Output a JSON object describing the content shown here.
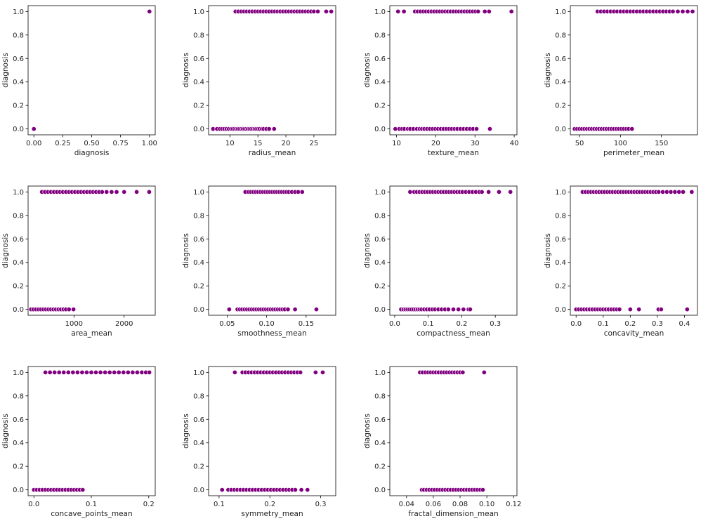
{
  "figure": {
    "background": "#ffffff"
  },
  "style": {
    "point_color": "#800080",
    "point_edge": "#ffffff"
  },
  "chart_data": [
    {
      "type": "scatter",
      "xlabel": "diagnosis",
      "ylabel": "diagnosis",
      "xlim": [
        -0.05,
        1.05
      ],
      "ylim": [
        -0.05,
        1.05
      ],
      "xticks": [
        0.0,
        0.25,
        0.5,
        0.75,
        1.0
      ],
      "xtick_labels": [
        "0.00",
        "0.25",
        "0.50",
        "0.75",
        "1.00"
      ],
      "yticks": [
        0.0,
        0.2,
        0.4,
        0.6,
        0.8,
        1.0
      ],
      "ytick_labels": [
        "0.0",
        "0.2",
        "0.4",
        "0.6",
        "0.8",
        "1.0"
      ],
      "points": {
        "y0": [
          0.0
        ],
        "y1": [
          1.0
        ]
      }
    },
    {
      "type": "scatter",
      "xlabel": "radius_mean",
      "ylabel": "diagnosis",
      "xlim": [
        6.2,
        28.9
      ],
      "ylim": [
        -0.05,
        1.05
      ],
      "xticks": [
        10,
        15,
        20,
        25
      ],
      "xtick_labels": [
        "10",
        "15",
        "20",
        "25"
      ],
      "yticks": [
        0.0,
        0.2,
        0.4,
        0.6,
        0.8,
        1.0
      ],
      "ytick_labels": [
        "0.0",
        "0.2",
        "0.4",
        "0.6",
        "0.8",
        "1.0"
      ],
      "points": {
        "y0": [
          7.0,
          7.7,
          8.2,
          8.6,
          9.0,
          9.4,
          9.8,
          10.2,
          10.5,
          10.8,
          11.1,
          11.4,
          11.7,
          12.0,
          12.3,
          12.6,
          12.9,
          13.2,
          13.5,
          13.8,
          14.1,
          14.4,
          14.7,
          15.0,
          15.3,
          15.7,
          16.0,
          16.5,
          17.0,
          17.9
        ],
        "y1": [
          11.0,
          11.5,
          12.0,
          12.5,
          13.0,
          13.5,
          14.0,
          14.5,
          15.0,
          15.5,
          16.0,
          16.5,
          17.0,
          17.5,
          18.0,
          18.5,
          19.0,
          19.5,
          20.0,
          20.5,
          21.0,
          21.5,
          22.0,
          22.5,
          23.0,
          23.5,
          24.0,
          24.5,
          25.0,
          25.7,
          27.2,
          28.1
        ]
      }
    },
    {
      "type": "scatter",
      "xlabel": "texture_mean",
      "ylabel": "diagnosis",
      "xlim": [
        8.3,
        40.7
      ],
      "ylim": [
        -0.05,
        1.05
      ],
      "xticks": [
        10,
        20,
        30,
        40
      ],
      "xtick_labels": [
        "10",
        "20",
        "30",
        "40"
      ],
      "yticks": [
        0.0,
        0.2,
        0.4,
        0.6,
        0.8,
        1.0
      ],
      "ytick_labels": [
        "0.0",
        "0.2",
        "0.4",
        "0.6",
        "0.8",
        "1.0"
      ],
      "points": {
        "y0": [
          9.7,
          10.7,
          11.4,
          12.0,
          12.9,
          13.5,
          14.3,
          15.2,
          15.9,
          16.5,
          17.1,
          17.8,
          18.5,
          19.2,
          19.9,
          20.6,
          21.3,
          22.0,
          22.7,
          23.4,
          24.1,
          24.8,
          25.5,
          26.3,
          27.1,
          27.9,
          28.7,
          29.5,
          30.4,
          33.8
        ],
        "y1": [
          10.4,
          11.9,
          14.7,
          15.4,
          16.1,
          16.8,
          17.5,
          18.2,
          18.9,
          19.6,
          20.3,
          21.0,
          21.7,
          22.4,
          23.1,
          23.8,
          24.5,
          25.2,
          25.9,
          26.6,
          27.3,
          28.0,
          28.7,
          29.4,
          30.1,
          30.8,
          32.5,
          33.6,
          39.3
        ]
      }
    },
    {
      "type": "scatter",
      "xlabel": "perimeter_mean",
      "ylabel": "diagnosis",
      "xlim": [
        38.8,
        194.0
      ],
      "ylim": [
        -0.05,
        1.05
      ],
      "xticks": [
        50,
        100,
        150
      ],
      "xtick_labels": [
        "50",
        "100",
        "150"
      ],
      "yticks": [
        0.0,
        0.2,
        0.4,
        0.6,
        0.8,
        1.0
      ],
      "ytick_labels": [
        "0.0",
        "0.2",
        "0.4",
        "0.6",
        "0.8",
        "1.0"
      ],
      "points": {
        "y0": [
          44,
          47,
          50,
          53,
          56,
          59,
          62,
          65,
          68,
          71,
          74,
          77,
          80,
          83,
          86,
          89,
          92,
          95,
          98,
          101,
          104,
          107,
          110,
          114
        ],
        "y1": [
          72,
          76,
          80,
          84,
          88,
          92,
          96,
          100,
          104,
          108,
          112,
          116,
          120,
          124,
          128,
          132,
          136,
          140,
          144,
          148,
          152,
          156,
          160,
          164,
          170,
          176,
          182,
          188
        ]
      }
    },
    {
      "type": "scatter",
      "xlabel": "area_mean",
      "ylabel": "diagnosis",
      "xlim": [
        85,
        2620
      ],
      "ylim": [
        -0.05,
        1.05
      ],
      "xticks": [
        1000,
        2000
      ],
      "xtick_labels": [
        "1000",
        "2000"
      ],
      "yticks": [
        0.0,
        0.2,
        0.4,
        0.6,
        0.8,
        1.0
      ],
      "ytick_labels": [
        "0.0",
        "0.2",
        "0.4",
        "0.6",
        "0.8",
        "1.0"
      ],
      "points": {
        "y0": [
          144,
          190,
          240,
          290,
          340,
          390,
          440,
          490,
          540,
          590,
          640,
          690,
          740,
          790,
          840,
          900,
          990
        ],
        "y1": [
          360,
          420,
          480,
          540,
          600,
          660,
          720,
          780,
          840,
          900,
          960,
          1020,
          1080,
          1140,
          1200,
          1260,
          1320,
          1380,
          1440,
          1500,
          1560,
          1650,
          1750,
          1850,
          2000,
          2250,
          2500
        ]
      }
    },
    {
      "type": "scatter",
      "xlabel": "smoothness_mean",
      "ylabel": "diagnosis",
      "xlim": [
        0.0265,
        0.1875
      ],
      "ylim": [
        -0.05,
        1.05
      ],
      "xticks": [
        0.05,
        0.1,
        0.15
      ],
      "xtick_labels": [
        "0.05",
        "0.10",
        "0.15"
      ],
      "yticks": [
        0.0,
        0.2,
        0.4,
        0.6,
        0.8,
        1.0
      ],
      "ytick_labels": [
        "0.0",
        "0.2",
        "0.4",
        "0.6",
        "0.8",
        "1.0"
      ],
      "points": {
        "y0": [
          0.0526,
          0.063,
          0.066,
          0.069,
          0.072,
          0.075,
          0.078,
          0.081,
          0.084,
          0.087,
          0.09,
          0.093,
          0.096,
          0.099,
          0.102,
          0.105,
          0.108,
          0.111,
          0.114,
          0.117,
          0.12,
          0.123,
          0.127,
          0.136,
          0.163
        ],
        "y1": [
          0.073,
          0.077,
          0.08,
          0.083,
          0.086,
          0.089,
          0.092,
          0.095,
          0.098,
          0.101,
          0.104,
          0.107,
          0.11,
          0.113,
          0.116,
          0.119,
          0.122,
          0.125,
          0.128,
          0.132,
          0.136,
          0.14,
          0.145
        ]
      }
    },
    {
      "type": "scatter",
      "xlabel": "compactness_mean",
      "ylabel": "diagnosis",
      "xlim": [
        -0.0145,
        0.3645
      ],
      "ylim": [
        -0.05,
        1.05
      ],
      "xticks": [
        0.0,
        0.1,
        0.2,
        0.3
      ],
      "xtick_labels": [
        "0.0",
        "0.1",
        "0.2",
        "0.3"
      ],
      "yticks": [
        0.0,
        0.2,
        0.4,
        0.6,
        0.8,
        1.0
      ],
      "ytick_labels": [
        "0.0",
        "0.2",
        "0.4",
        "0.6",
        "0.8",
        "1.0"
      ],
      "points": {
        "y0": [
          0.019,
          0.026,
          0.032,
          0.038,
          0.044,
          0.05,
          0.056,
          0.062,
          0.068,
          0.074,
          0.08,
          0.088,
          0.096,
          0.104,
          0.112,
          0.12,
          0.13,
          0.14,
          0.15,
          0.16,
          0.175,
          0.19,
          0.205,
          0.22,
          0.225
        ],
        "y1": [
          0.046,
          0.058,
          0.066,
          0.074,
          0.082,
          0.09,
          0.098,
          0.106,
          0.114,
          0.122,
          0.13,
          0.138,
          0.146,
          0.154,
          0.162,
          0.17,
          0.178,
          0.186,
          0.194,
          0.202,
          0.212,
          0.222,
          0.232,
          0.242,
          0.252,
          0.26,
          0.28,
          0.311,
          0.345
        ]
      }
    },
    {
      "type": "scatter",
      "xlabel": "concavity_mean",
      "ylabel": "diagnosis",
      "xlim": [
        -0.0213,
        0.4481
      ],
      "ylim": [
        -0.05,
        1.05
      ],
      "xticks": [
        0.0,
        0.1,
        0.2,
        0.3,
        0.4
      ],
      "xtick_labels": [
        "0.0",
        "0.1",
        "0.2",
        "0.3",
        "0.4"
      ],
      "yticks": [
        0.0,
        0.2,
        0.4,
        0.6,
        0.8,
        1.0
      ],
      "ytick_labels": [
        "0.0",
        "0.2",
        "0.4",
        "0.6",
        "0.8",
        "1.0"
      ],
      "points": {
        "y0": [
          0.0,
          0.01,
          0.02,
          0.03,
          0.04,
          0.05,
          0.06,
          0.07,
          0.08,
          0.09,
          0.1,
          0.11,
          0.12,
          0.13,
          0.14,
          0.15,
          0.16,
          0.2,
          0.232,
          0.304,
          0.314,
          0.41
        ],
        "y1": [
          0.024,
          0.035,
          0.045,
          0.055,
          0.065,
          0.075,
          0.085,
          0.095,
          0.105,
          0.115,
          0.125,
          0.135,
          0.145,
          0.155,
          0.165,
          0.175,
          0.185,
          0.195,
          0.205,
          0.215,
          0.225,
          0.235,
          0.245,
          0.255,
          0.265,
          0.275,
          0.285,
          0.295,
          0.305,
          0.32,
          0.335,
          0.35,
          0.365,
          0.38,
          0.395,
          0.427
        ]
      }
    },
    {
      "type": "scatter",
      "xlabel": "concave_points_mean",
      "ylabel": "diagnosis",
      "xlim": [
        -0.0101,
        0.2113
      ],
      "ylim": [
        -0.05,
        1.05
      ],
      "xticks": [
        0.0,
        0.1,
        0.2
      ],
      "xtick_labels": [
        "0.0",
        "0.1",
        "0.2"
      ],
      "yticks": [
        0.0,
        0.2,
        0.4,
        0.6,
        0.8,
        1.0
      ],
      "ytick_labels": [
        "0.0",
        "0.2",
        "0.4",
        "0.6",
        "0.8",
        "1.0"
      ],
      "points": {
        "y0": [
          0.0,
          0.005,
          0.01,
          0.015,
          0.02,
          0.025,
          0.03,
          0.035,
          0.04,
          0.045,
          0.05,
          0.055,
          0.06,
          0.065,
          0.07,
          0.075,
          0.08,
          0.085
        ],
        "y1": [
          0.02,
          0.028,
          0.036,
          0.044,
          0.052,
          0.06,
          0.068,
          0.076,
          0.084,
          0.092,
          0.1,
          0.108,
          0.116,
          0.124,
          0.132,
          0.14,
          0.148,
          0.156,
          0.164,
          0.172,
          0.18,
          0.188,
          0.195,
          0.201
        ]
      }
    },
    {
      "type": "scatter",
      "xlabel": "symmetry_mean",
      "ylabel": "diagnosis",
      "xlim": [
        0.0794,
        0.3296
      ],
      "ylim": [
        -0.05,
        1.05
      ],
      "xticks": [
        0.1,
        0.2,
        0.3
      ],
      "xtick_labels": [
        "0.1",
        "0.2",
        "0.3"
      ],
      "yticks": [
        0.0,
        0.2,
        0.4,
        0.6,
        0.8,
        1.0
      ],
      "ytick_labels": [
        "0.0",
        "0.2",
        "0.4",
        "0.6",
        "0.8",
        "1.0"
      ],
      "points": {
        "y0": [
          0.106,
          0.118,
          0.124,
          0.13,
          0.136,
          0.142,
          0.148,
          0.154,
          0.16,
          0.166,
          0.172,
          0.178,
          0.184,
          0.19,
          0.196,
          0.202,
          0.208,
          0.214,
          0.22,
          0.226,
          0.232,
          0.238,
          0.244,
          0.25,
          0.262,
          0.274
        ],
        "y1": [
          0.131,
          0.146,
          0.152,
          0.158,
          0.164,
          0.17,
          0.176,
          0.182,
          0.188,
          0.194,
          0.2,
          0.206,
          0.212,
          0.218,
          0.224,
          0.23,
          0.236,
          0.242,
          0.248,
          0.254,
          0.26,
          0.29,
          0.304
        ]
      }
    },
    {
      "type": "scatter",
      "xlabel": "fractal_dimension_mean",
      "ylabel": "diagnosis",
      "xlim": [
        0.0275,
        0.1225
      ],
      "ylim": [
        -0.05,
        1.05
      ],
      "xticks": [
        0.04,
        0.06,
        0.08,
        0.1,
        0.12
      ],
      "xtick_labels": [
        "0.04",
        "0.06",
        "0.08",
        "0.10",
        "0.12"
      ],
      "yticks": [
        0.0,
        0.2,
        0.4,
        0.6,
        0.8,
        1.0
      ],
      "ytick_labels": [
        "0.0",
        "0.2",
        "0.4",
        "0.6",
        "0.8",
        "1.0"
      ],
      "points": {
        "y0": [
          0.0514,
          0.053,
          0.055,
          0.057,
          0.059,
          0.061,
          0.063,
          0.065,
          0.067,
          0.069,
          0.071,
          0.073,
          0.075,
          0.077,
          0.079,
          0.081,
          0.083,
          0.085,
          0.087,
          0.089,
          0.091,
          0.093,
          0.095,
          0.097
        ],
        "y1": [
          0.05,
          0.052,
          0.054,
          0.056,
          0.058,
          0.06,
          0.062,
          0.064,
          0.066,
          0.068,
          0.07,
          0.072,
          0.074,
          0.076,
          0.078,
          0.08,
          0.082,
          0.098
        ]
      }
    }
  ]
}
